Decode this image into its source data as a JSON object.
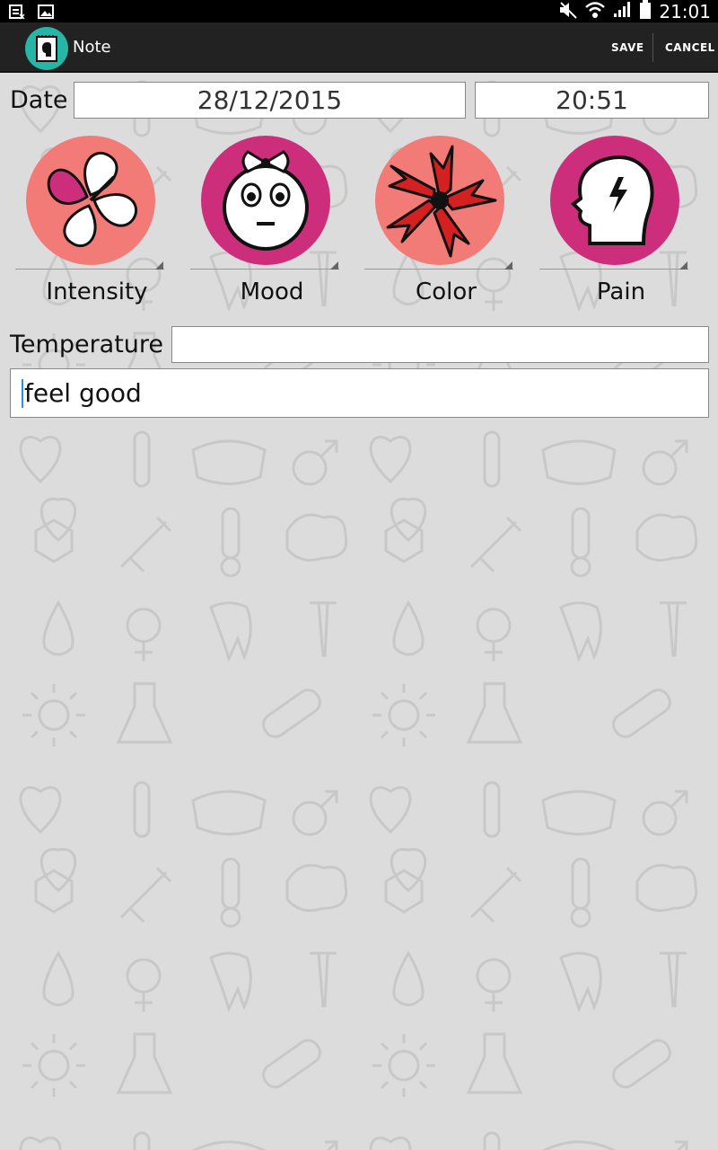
{
  "status_bar": {
    "time": "21:01"
  },
  "action_bar": {
    "title": "Note",
    "save_label": "SAVE",
    "cancel_label": "CANCEL"
  },
  "form": {
    "date_label": "Date",
    "date_value": "28/12/2015",
    "time_value": "20:51",
    "spinners": [
      {
        "label": "Intensity",
        "icon": "clover-icon",
        "bg": "#f27b77"
      },
      {
        "label": "Mood",
        "icon": "face-icon",
        "bg": "#cc2e7c"
      },
      {
        "label": "Color",
        "icon": "flower-icon",
        "bg": "#f27b77"
      },
      {
        "label": "Pain",
        "icon": "head-pain-icon",
        "bg": "#cc2e7c"
      }
    ],
    "temperature_label": "Temperature",
    "temperature_value": "",
    "note_value": "feel good"
  }
}
